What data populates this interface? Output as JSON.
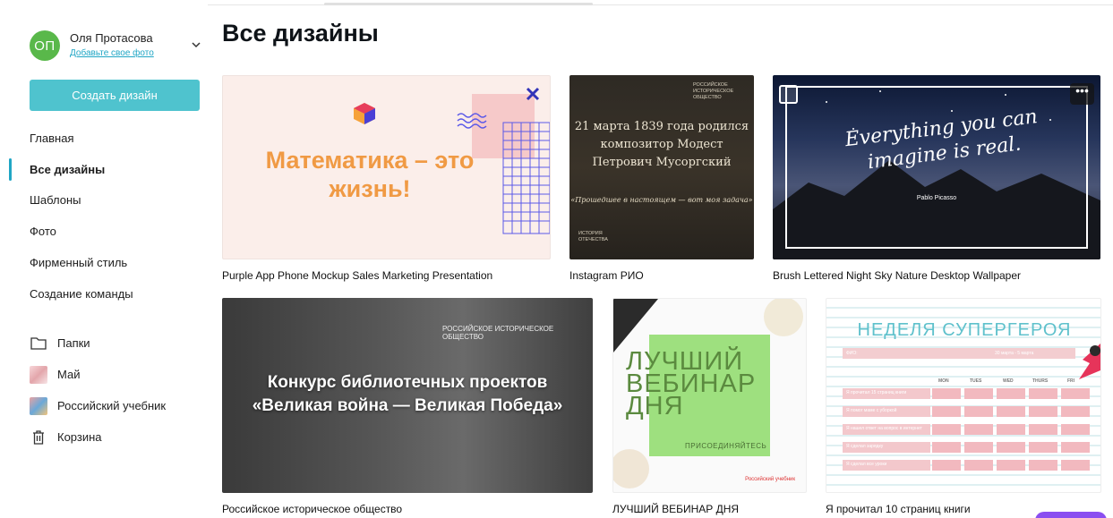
{
  "user": {
    "avatar_initials": "ОП",
    "name": "Оля Протасова",
    "add_photo": "Добавьте свое фото"
  },
  "sidebar": {
    "create_button": "Создать дизайн",
    "nav": [
      {
        "label": "Главная",
        "active": false
      },
      {
        "label": "Все дизайны",
        "active": true
      },
      {
        "label": "Шаблоны",
        "active": false
      },
      {
        "label": "Фото",
        "active": false
      },
      {
        "label": "Фирменный стиль",
        "active": false
      },
      {
        "label": "Создание команды",
        "active": false
      }
    ],
    "folders": [
      {
        "label": "Папки",
        "icon": "folder-icon"
      },
      {
        "label": "Май",
        "icon": "folder-thumbnail"
      },
      {
        "label": "Российский учебник",
        "icon": "folder-thumbnail"
      },
      {
        "label": "Корзина",
        "icon": "trash-icon"
      }
    ]
  },
  "main": {
    "title": "Все дизайны",
    "designs": [
      {
        "caption": "Purple App Phone Mockup Sales Marketing Presentation",
        "preview_text": "Математика – это жизнь!"
      },
      {
        "caption": "Instagram РИО",
        "preview_text": "21 марта 1839 года родился композитор Модест Петрович Мусоргский",
        "preview_quote": "«Прошедшее в настоящем — вот моя задача»",
        "preview_logo": "Российское историческое общество",
        "preview_logo2": "История Отечества"
      },
      {
        "caption": "Brush Lettered Night Sky Nature Desktop Wallpaper",
        "preview_text": "Everything you can imagine is real.",
        "preview_author": "Pablo Picasso",
        "more_label": "•••"
      },
      {
        "caption": "Российское историческое общество",
        "preview_text_line1": "Конкурс библиотечных проектов",
        "preview_text_line2": "«Великая война — Великая Победа»",
        "preview_logo": "Российское историческое общество"
      },
      {
        "caption": "ЛУЧШИЙ ВЕБИНАР ДНЯ",
        "preview_text": "ЛУЧШИЙ ВЕБИНАР ДНЯ",
        "preview_sub": "ПРИСОЕДИНЯЙТЕСЬ",
        "preview_brand": "Российский учебник"
      },
      {
        "caption": "Я прочитал 10 страниц книги",
        "preview_title": "НЕДЕЛЯ СУПЕРГЕРОЯ",
        "preview_fio": "ФИО:",
        "preview_dates": "30 марта - 5 марта",
        "days": [
          "MON",
          "TUES",
          "WED",
          "THURS",
          "FRI"
        ],
        "rows": [
          "Я прочитал 15 страниц книги",
          "Я помог маме с уборкой",
          "Я нашел ответ на вопрос в интернет",
          "Я сделал зарядку",
          "Я сделал все уроки"
        ]
      }
    ]
  },
  "colors": {
    "accent": "#20a6c5",
    "create_button": "#4fc3ce",
    "avatar": "#59b84a"
  }
}
